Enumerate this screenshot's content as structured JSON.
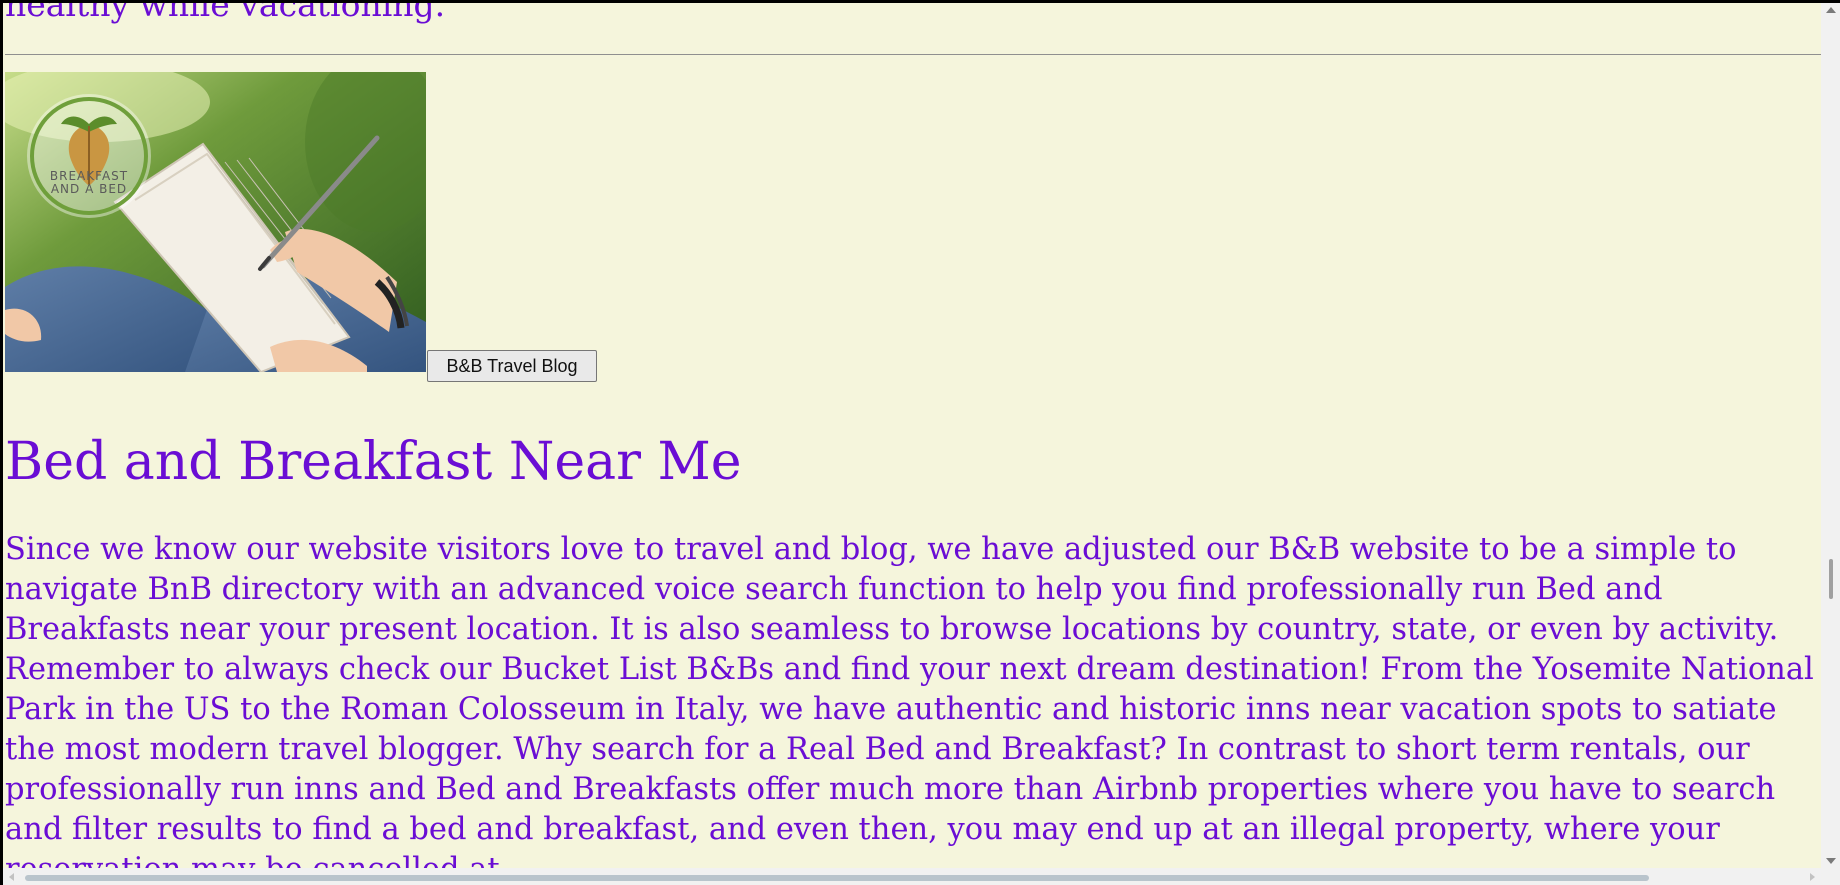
{
  "page": {
    "top_text": "healthy while vacationing.",
    "title": "Bed and Breakfast Near Me",
    "paragraph": "Since we know our website visitors love to travel and blog, we have adjusted our B&B website to be a simple to navigate BnB directory with an advanced voice search function to help you find professionally run Bed and Breakfasts near your present location. It is also seamless to browse locations by country, state, or even by activity. Remember to always check our Bucket List B&Bs and find your next dream destination! From the Yosemite National Park in the US to the Roman Colosseum in Italy, we have authentic and historic inns near vacation spots to satiate the most modern travel blogger. Why search for a Real Bed and Breakfast? In contrast to short term rentals, our professionally run inns and Bed and Breakfasts offer much more than Airbnb properties where you have to search and filter results to find a bed and breakfast, and even then, you may end up at an illegal property, where your reservation may be cancelled at"
  },
  "promo": {
    "logo_line_1": "BREAKFAST",
    "logo_line_2": "AND A BED",
    "button_label": "B&B Travel Blog",
    "image_icon": "person-writing-notebook-image",
    "logo_icon": "breakfast-and-a-bed-logo"
  },
  "colors": {
    "page_background": "#f5f5dc",
    "text": "#6a0dd4"
  }
}
